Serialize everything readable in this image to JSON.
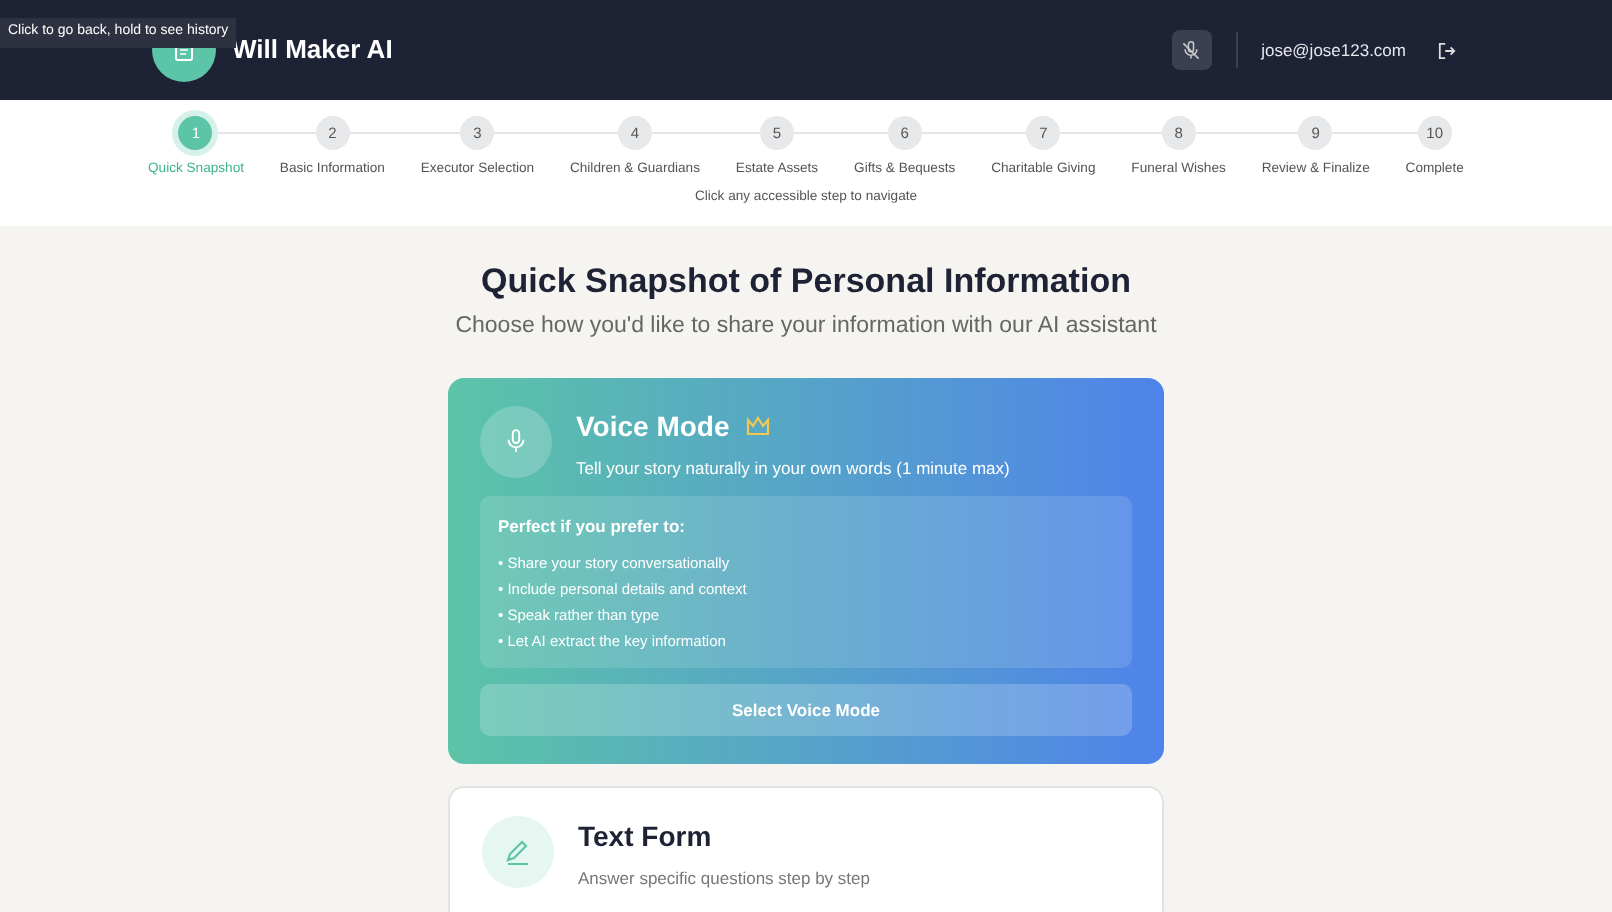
{
  "header": {
    "title": "Will Maker AI",
    "user_email": "jose@jose123.com",
    "tooltip": "Click to go back, hold to see history",
    "mic_muted": true
  },
  "steps": [
    {
      "number": "1",
      "label": "Quick Snapshot",
      "selected": true
    },
    {
      "number": "2",
      "label": "Basic Information",
      "selected": false
    },
    {
      "number": "3",
      "label": "Executor Selection",
      "selected": false
    },
    {
      "number": "4",
      "label": "Children & Guardians",
      "selected": false
    },
    {
      "number": "5",
      "label": "Estate Assets",
      "selected": false
    },
    {
      "number": "6",
      "label": "Gifts & Bequests",
      "selected": false
    },
    {
      "number": "7",
      "label": "Charitable Giving",
      "selected": false
    },
    {
      "number": "8",
      "label": "Funeral Wishes",
      "selected": false
    },
    {
      "number": "9",
      "label": "Review & Finalize",
      "selected": false
    },
    {
      "number": "10",
      "label": "Complete",
      "selected": false
    }
  ],
  "step_hint": "Click any accessible step to navigate",
  "page": {
    "title": "Quick Snapshot of Personal Information",
    "subtitle": "Choose how you'd like to share your information with our AI assistant"
  },
  "modes": [
    {
      "kind": "voice",
      "title": "Voice Mode",
      "premium": true,
      "description": "Tell your story naturally in your own words (1 minute max)",
      "benefits_title": "Perfect if you prefer to:",
      "benefits": [
        "• Share your story conversationally",
        "• Include personal details and context",
        "• Speak rather than type",
        "• Let AI extract the key information"
      ],
      "button": "Select Voice Mode"
    },
    {
      "kind": "text",
      "title": "Text Form",
      "premium": false,
      "description": "Answer specific questions step by step"
    }
  ]
}
